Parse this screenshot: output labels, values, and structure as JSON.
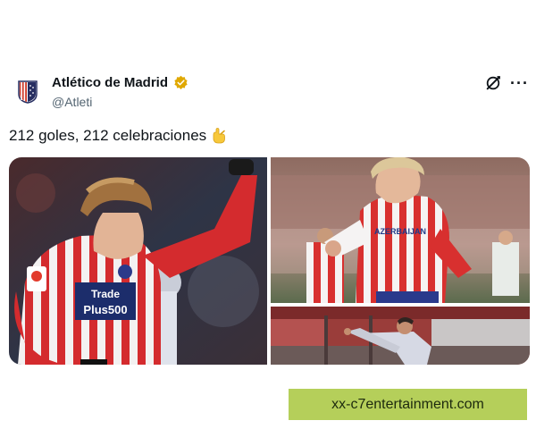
{
  "tweet": {
    "display_name": "Atlético de Madrid",
    "handle": "@Atleti",
    "verified": true,
    "text": "212 goles, 212 celebraciones",
    "text_emoji": "call-me-hand-emoji",
    "more_label": "···",
    "grok_icon": "grok-icon",
    "media": {
      "count": 3,
      "photo_1": {
        "sponsor_line_1": "Trade",
        "sponsor_line_2": "Plus500"
      },
      "photo_2": {
        "sponsor": "AZERBAIJAN"
      }
    }
  },
  "watermark": "xx-c7entertainment.com",
  "colors": {
    "verified_badge": "#e0a800",
    "atleti_red": "#cb3524",
    "atleti_blue": "#272e61",
    "handle_gray": "#536471",
    "watermark_bg": "#b5cf5a"
  }
}
